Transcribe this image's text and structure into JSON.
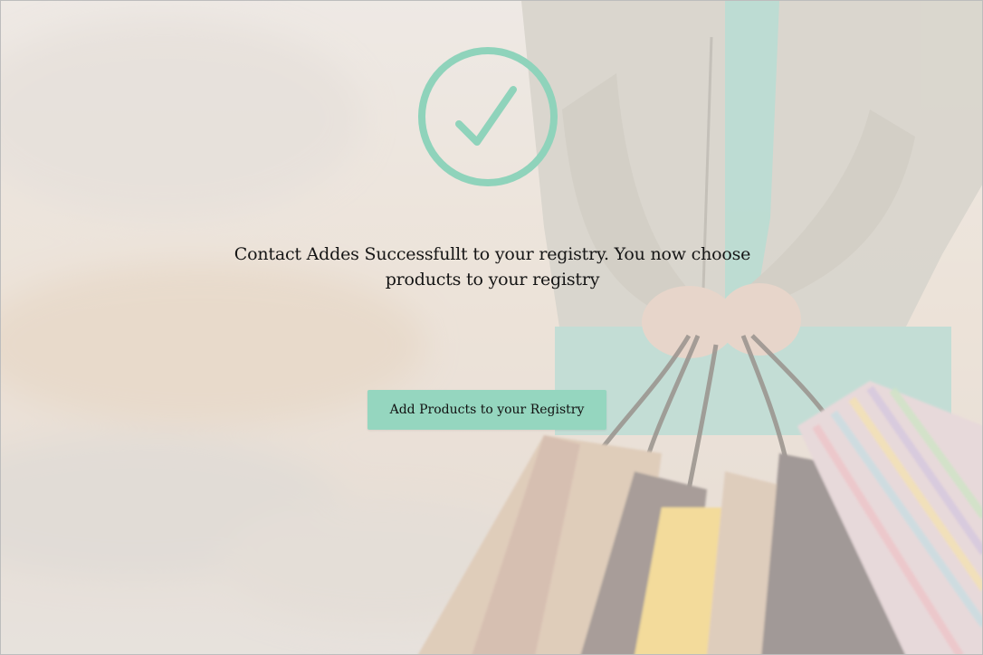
{
  "success": {
    "message": "Contact Addes Successfullt to your registry. You now choose products to your registry",
    "cta_label": "Add Products to your Registry",
    "icon": "checkmark-circle-icon"
  },
  "colors": {
    "accent": "#8fd3bb",
    "button_bg": "#95d6bf",
    "text": "#151515"
  }
}
